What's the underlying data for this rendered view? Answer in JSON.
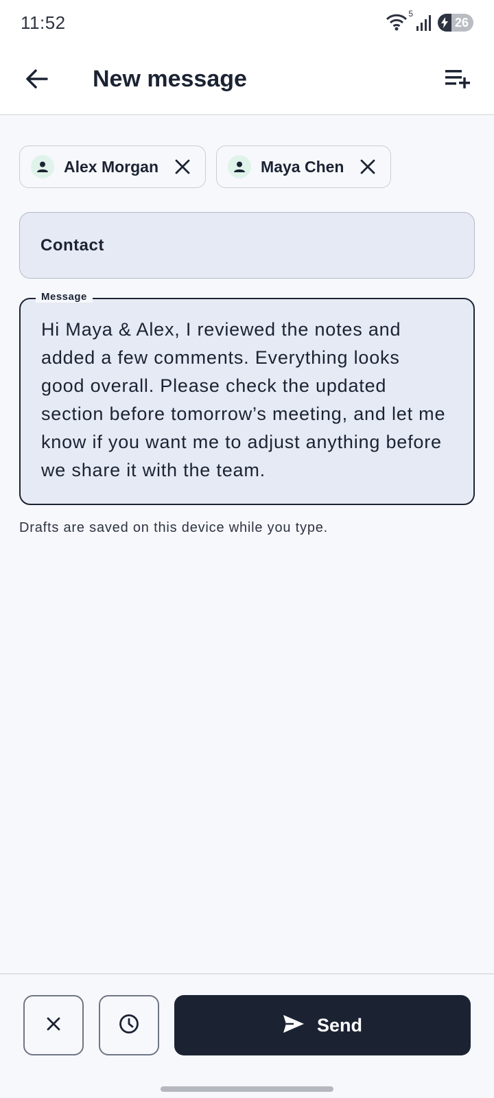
{
  "status_bar": {
    "time": "11:52",
    "wifi_badge": "5",
    "battery_level": "26",
    "icons": [
      "wifi-icon",
      "signal-icon",
      "battery-charging-icon"
    ]
  },
  "app_bar": {
    "title": "New message",
    "back_icon": "arrow-left-icon",
    "action_icon": "playlist-add-icon"
  },
  "recipients": [
    {
      "name": "Alex Morgan",
      "avatar_icon": "person-icon",
      "remove_icon": "close-icon"
    },
    {
      "name": "Maya Chen",
      "avatar_icon": "person-icon",
      "remove_icon": "close-icon"
    }
  ],
  "contact_field": {
    "placeholder": "Contact"
  },
  "message_field": {
    "label": "Message",
    "value": "Hi Maya & Alex, I reviewed the notes and added a few comments. Everything looks good overall. Please check the updated section before tomorrow’s meeting, and let me know if you want me to adjust anything before we share it with the team."
  },
  "helper_text": "Drafts are saved on this device while you type.",
  "bottom_bar": {
    "discard_icon": "close-icon",
    "schedule_icon": "clock-icon",
    "send_label": "Send",
    "send_icon": "send-icon"
  },
  "colors": {
    "primary": "#1b2333",
    "background": "#f6f8fc",
    "field_fill": "#e6eaf4",
    "avatar_fill": "#dff3ea"
  }
}
